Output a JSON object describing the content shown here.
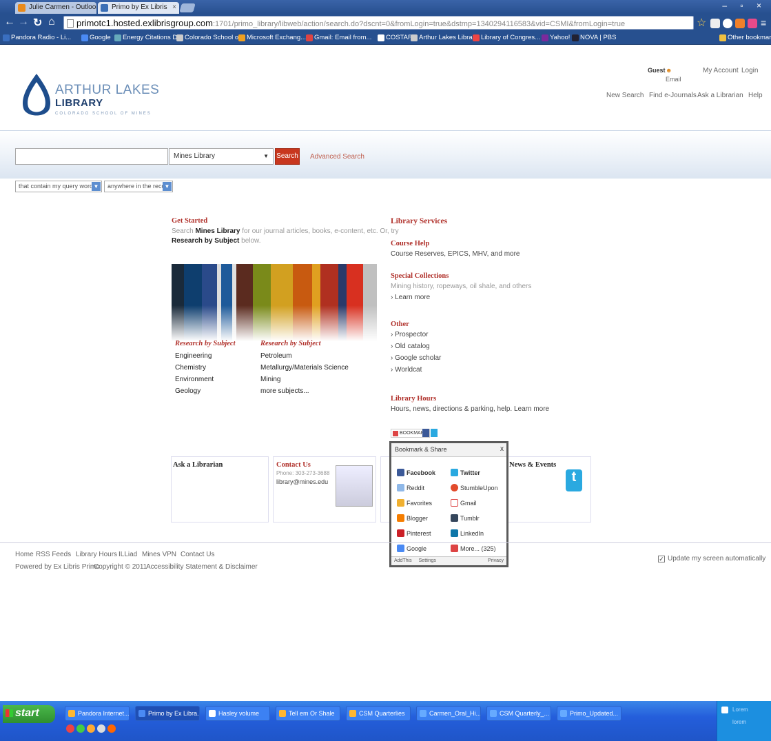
{
  "browser": {
    "tabs": [
      {
        "label": "Julie Carmen - Outlook"
      },
      {
        "label": "Primo by Ex Libris"
      }
    ],
    "window_controls": "– ▫ ×",
    "url_host": "primotc1.hosted.exlibrisgroup.com",
    "url_rest": ":1701/primo_library/libweb/action/search.do?dscnt=0&fromLogin=true&dstmp=1340294116583&vid=CSMI&fromLogin=true",
    "bookmarks": [
      {
        "label": "Pandora Radio - Li..."
      },
      {
        "label": "Google"
      },
      {
        "label": "Energy Citations D..."
      },
      {
        "label": "Colorado School o..."
      },
      {
        "label": "Microsoft Exchang..."
      },
      {
        "label": "Gmail: Email from..."
      },
      {
        "label": "COSTAR"
      },
      {
        "label": "Arthur Lakes Libra..."
      },
      {
        "label": "Library of Congres..."
      },
      {
        "label": "Yahoo!"
      },
      {
        "label": "NOVA | PBS"
      }
    ],
    "other_bookmarks": "Other bookmarks"
  },
  "header": {
    "logo_title": "ARTHUR LAKES",
    "logo_sub": "LIBRARY",
    "logo_tag": "COLORADO SCHOOL OF MINES",
    "guest": "Guest",
    "email": "Email",
    "my_account": "My Account",
    "login": "Login",
    "links": [
      "New Search",
      "Find e-Journals",
      "Ask a Librarian",
      "Help"
    ]
  },
  "search": {
    "query": "",
    "scope": "Mines Library",
    "button": "Search",
    "advanced": "Advanced Search",
    "filter1": "that contain my query words",
    "filter2": "anywhere in the record"
  },
  "get_started": {
    "title": "Get Started",
    "line1_pre": "Search ",
    "line1_bold": "Mines Library",
    "line1_post": " for our journal articles, books, e-content, etc. Or, try",
    "line2": "Research by Subject",
    "line2_post": " below."
  },
  "research1": {
    "title": "Research by Subject",
    "items": [
      "Engineering",
      "Chemistry",
      "Environment",
      "Geology"
    ]
  },
  "research2": {
    "title": "Research by Subject",
    "items": [
      "Petroleum",
      "Metallurgy/Materials Science",
      "Mining",
      "more subjects..."
    ]
  },
  "library_services": {
    "title": "Library Services",
    "course_help_title": "Course Help",
    "course_help_text": "Course Reserves, EPICS, MHV, and more",
    "special_title": "Special Collections",
    "special_text": "Mining history, ropeways, oil shale, and others",
    "learn_more": "› Learn more",
    "other_title": "Other",
    "other_items": [
      "› Prospector",
      "› Old catalog",
      "› Google scholar",
      "› Worldcat"
    ],
    "hours_title": "Library Hours",
    "hours_text": "Hours, news, directions & parking, help. Learn more"
  },
  "share": {
    "bookmark_btn": "BOOKMARK",
    "popup_title": "Bookmark & Share",
    "close": "x",
    "items": [
      {
        "label": "Facebook",
        "color": "#3b5998"
      },
      {
        "label": "Twitter",
        "color": "#2aa9e0"
      },
      {
        "label": "Reddit",
        "color": "#8fb8e8"
      },
      {
        "label": "StumbleUpon",
        "color": "#e24b2c"
      },
      {
        "label": "Favorites",
        "color": "#f0b030"
      },
      {
        "label": "Gmail",
        "color": "#d44"
      },
      {
        "label": "Blogger",
        "color": "#f57d00"
      },
      {
        "label": "Tumblr",
        "color": "#35465c"
      },
      {
        "label": "Pinterest",
        "color": "#cb2027"
      },
      {
        "label": "LinkedIn",
        "color": "#0e76a8"
      },
      {
        "label": "Google",
        "color": "#4a8af4"
      },
      {
        "label": "More... (325)",
        "color": "#d44"
      }
    ],
    "footer_left": "AddThis",
    "footer_settings": "Settings",
    "footer_right": "Privacy"
  },
  "boxes": {
    "ask": "Ask a Librarian",
    "contact_title": "Contact Us",
    "contact_phone": "Phone: 303-273-3688",
    "contact_email": "library@mines.edu",
    "news": "News & Events"
  },
  "footer": {
    "links": [
      "Home",
      "RSS Feeds",
      "Library Hours",
      "ILLiad",
      "Mines VPN",
      "Contact Us"
    ],
    "powered": "Powered by Ex Libris Primo",
    "copyright": "Copyright © 2011",
    "accessibility": "Accessibility Statement & Disclaimer",
    "update_label": "Update my screen automatically"
  },
  "taskbar": {
    "start": "start",
    "tasks": [
      "Pandora Internet...",
      "Primo by Ex Libra...",
      "Hasley volume",
      "Tell em Or Shale",
      "CSM Quarterlies",
      "Carmen_Oral_Hi...",
      "CSM Quarterly_...",
      "Primo_Updated..."
    ],
    "tray_line1": "Lorem",
    "tray_line2": "lorem"
  }
}
